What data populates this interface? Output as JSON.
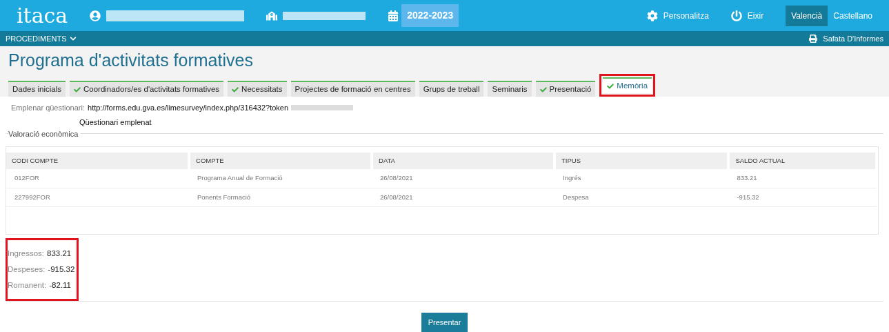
{
  "header": {
    "logo": "itaca",
    "user_redacted": true,
    "school_redacted": true,
    "year": "2022-2023",
    "actions": [
      {
        "kind": "settings",
        "label": "Personalitza"
      },
      {
        "kind": "power",
        "label": "Eixir"
      }
    ],
    "languages": [
      {
        "label": "Valencià",
        "selected": true
      },
      {
        "label": "Castellano",
        "selected": false
      }
    ]
  },
  "subbar": {
    "menu": "PROCEDIMENTS",
    "reports": "Safata D'Informes"
  },
  "title": "Programa d'activitats formatives",
  "tabs": [
    {
      "label": "Dades inicials",
      "checked": false,
      "selected": false,
      "highlighted": false
    },
    {
      "label": "Coordinadors/es d'activitats formatives",
      "checked": true,
      "selected": false,
      "highlighted": false
    },
    {
      "label": "Necessitats",
      "checked": true,
      "selected": false,
      "highlighted": false
    },
    {
      "label": "Projectes de formació en centres",
      "checked": false,
      "selected": false,
      "highlighted": false
    },
    {
      "label": "Grups de treball",
      "checked": false,
      "selected": false,
      "highlighted": false
    },
    {
      "label": "Seminaris",
      "checked": false,
      "selected": false,
      "highlighted": false
    },
    {
      "label": "Presentació",
      "checked": true,
      "selected": false,
      "highlighted": false
    },
    {
      "label": "Memòria",
      "checked": true,
      "selected": true,
      "highlighted": true
    }
  ],
  "questionnaire": {
    "label": "Emplenar qüestionari:",
    "url": "http://forms.edu.gva.es/limesurvey/index.php/316432?token",
    "status": "Qüestionari emplenat"
  },
  "valuation": {
    "legend": "Valoració econòmica",
    "columns": [
      "CODI COMPTE",
      "COMPTE",
      "DATA",
      "TIPUS",
      "SALDO ACTUAL"
    ],
    "rows": [
      [
        "012FOR",
        "Programa Anual de Formació",
        "26/08/2021",
        "Ingrés",
        "833.21"
      ],
      [
        "227992FOR",
        "Ponents Formació",
        "26/08/2021",
        "Despesa",
        "-915.32"
      ]
    ],
    "totals_highlighted": true,
    "totals": [
      {
        "label": "Ingressos:",
        "value": "833.21"
      },
      {
        "label": "Despeses:",
        "value": "-915.32"
      },
      {
        "label": "Romanent:",
        "value": "-82.11"
      }
    ]
  },
  "submit": "Presentar"
}
